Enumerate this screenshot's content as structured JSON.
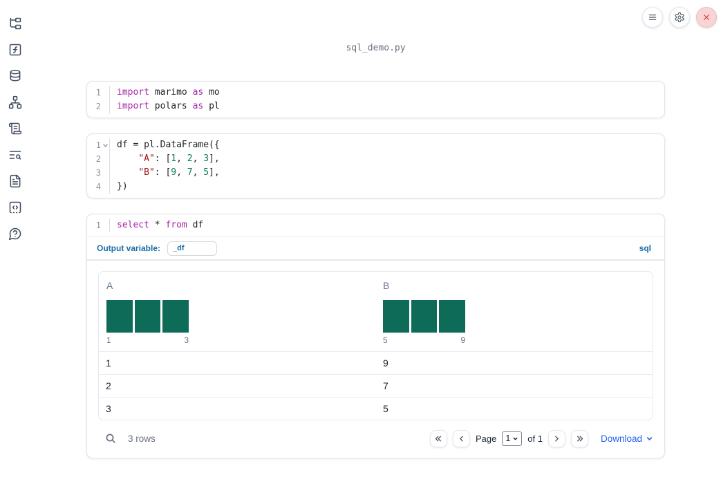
{
  "colors": {
    "accent_blue": "#1b6ea6",
    "link_blue": "#2563eb",
    "keyword": "#a626a4",
    "string": "#a31515",
    "number": "#0e7857",
    "histogram_bar": "#0d6b57",
    "close_red": "#d84040",
    "icon_slate": "#3f4a5f"
  },
  "filename": "sql_demo.py",
  "sidebar": {
    "items": [
      {
        "name": "file-explorer"
      },
      {
        "name": "variables"
      },
      {
        "name": "data-sources"
      },
      {
        "name": "dependency-graph"
      },
      {
        "name": "scratchpad"
      },
      {
        "name": "logs"
      },
      {
        "name": "documentation"
      },
      {
        "name": "snippets"
      },
      {
        "name": "help"
      }
    ]
  },
  "cells": [
    {
      "name": "imports-cell",
      "lines": [
        {
          "num": "1",
          "tokens": [
            [
              "import",
              "kw"
            ],
            [
              " marimo ",
              ""
            ],
            [
              "as",
              "kw"
            ],
            [
              " mo",
              ""
            ]
          ]
        },
        {
          "num": "2",
          "tokens": [
            [
              "import",
              "kw"
            ],
            [
              " polars ",
              ""
            ],
            [
              "as",
              "kw"
            ],
            [
              " pl",
              ""
            ]
          ]
        }
      ]
    },
    {
      "name": "dataframe-cell",
      "lines": [
        {
          "num": "1",
          "fold": true,
          "tokens": [
            [
              "df = pl.DataFrame({",
              ""
            ]
          ]
        },
        {
          "num": "2",
          "tokens": [
            [
              "    ",
              ""
            ],
            [
              "\"A\"",
              "str"
            ],
            [
              ": [",
              ""
            ],
            [
              "1",
              "num"
            ],
            [
              ", ",
              ""
            ],
            [
              "2",
              "num"
            ],
            [
              ", ",
              ""
            ],
            [
              "3",
              "num"
            ],
            [
              "],",
              ""
            ]
          ]
        },
        {
          "num": "3",
          "tokens": [
            [
              "    ",
              ""
            ],
            [
              "\"B\"",
              "str"
            ],
            [
              ": [",
              ""
            ],
            [
              "9",
              "num"
            ],
            [
              ", ",
              ""
            ],
            [
              "7",
              "num"
            ],
            [
              ", ",
              ""
            ],
            [
              "5",
              "num"
            ],
            [
              "],",
              ""
            ]
          ]
        },
        {
          "num": "4",
          "tokens": [
            [
              "})",
              ""
            ]
          ]
        }
      ]
    },
    {
      "name": "sql-cell",
      "lines": [
        {
          "num": "1",
          "tokens": [
            [
              "select",
              "kw"
            ],
            [
              " * ",
              ""
            ],
            [
              "from",
              "kw"
            ],
            [
              " df",
              ""
            ]
          ]
        }
      ]
    }
  ],
  "sql_bar": {
    "label": "Output variable:",
    "variable": "_df",
    "dialect": "sql"
  },
  "table": {
    "columns": [
      {
        "label": "A",
        "histogram": {
          "bars": [
            1,
            1,
            1
          ],
          "min": "1",
          "max": "3"
        }
      },
      {
        "label": "B",
        "histogram": {
          "bars": [
            1,
            1,
            1
          ],
          "min": "5",
          "max": "9"
        }
      }
    ],
    "rows": [
      [
        "1",
        "9"
      ],
      [
        "2",
        "7"
      ],
      [
        "3",
        "5"
      ]
    ],
    "footer": {
      "row_count": "3 rows",
      "page_label": "Page",
      "page_value": "1",
      "page_total": "of 1",
      "download_label": "Download"
    }
  }
}
